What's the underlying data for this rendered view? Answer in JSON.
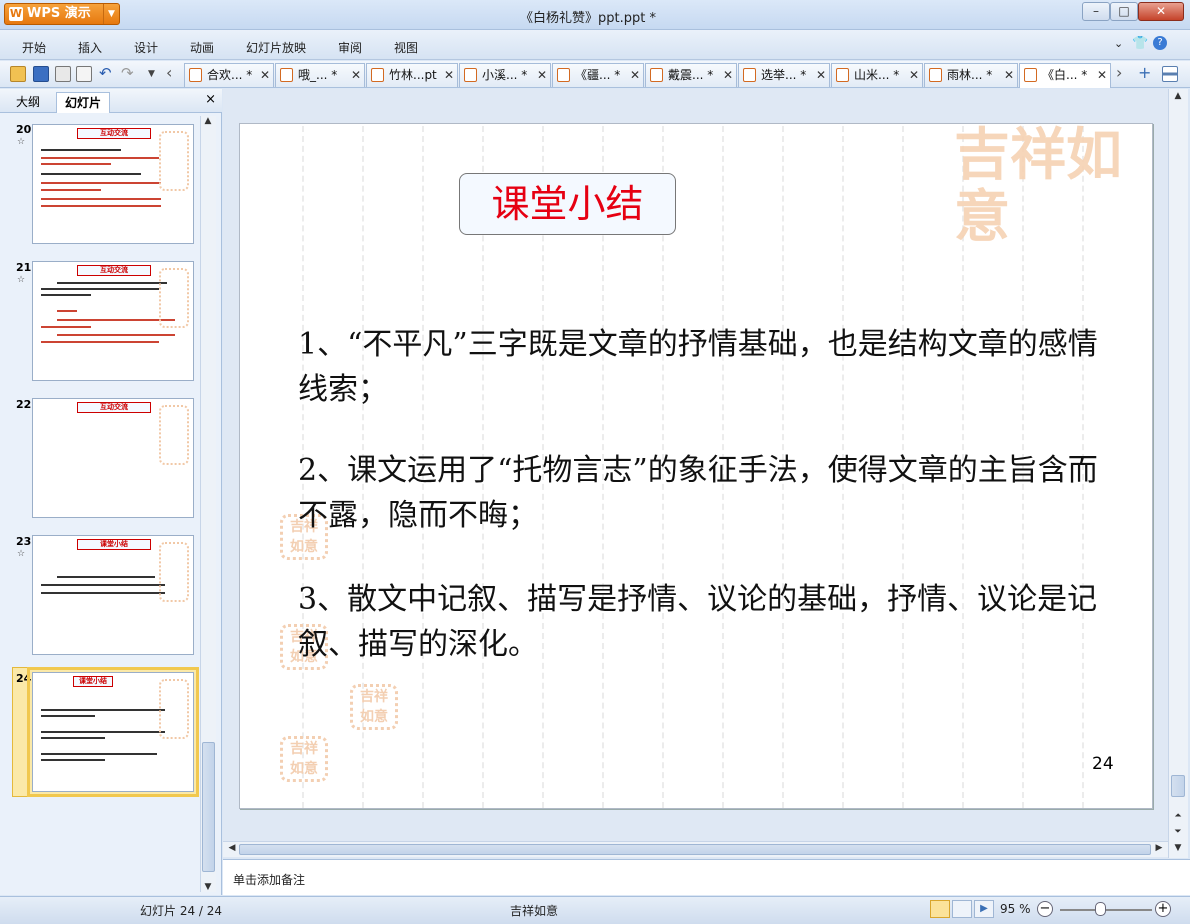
{
  "app": {
    "name": "WPS 演示",
    "doc_title": "《白杨礼赞》ppt.ppt *"
  },
  "menu": [
    "开始",
    "插入",
    "设计",
    "动画",
    "幻灯片放映",
    "审阅",
    "视图"
  ],
  "doc_tabs": [
    "合欢... *",
    "哦_... *",
    "竹林...pt",
    "小溪... *",
    "《疆... *",
    "戴震... *",
    "选举... *",
    "山米... *",
    "雨林... *",
    "《白... *"
  ],
  "panel": {
    "tabs": [
      "大纲",
      "幻灯片"
    ],
    "close": "×"
  },
  "thumbnails": [
    {
      "num": "20",
      "title": "互动交流",
      "star": "☆"
    },
    {
      "num": "21",
      "title": "互动交流",
      "star": "☆"
    },
    {
      "num": "22",
      "title": "互动交流",
      "star": ""
    },
    {
      "num": "23",
      "title": "课堂小结",
      "star": "☆"
    },
    {
      "num": "24",
      "title": "课堂小结",
      "star": "",
      "selected": true
    }
  ],
  "slide": {
    "title": "课堂小结",
    "points": [
      "1、“不平凡”三字既是文章的抒情基础，也是结构文章的感情线索；",
      "2、课文运用了“托物言志”的象征手法，使得文章的主旨含而不露，隐而不晦；",
      "3、散文中记叙、描写是抒情、议论的基础，抒情、议论是记叙、描写的深化。"
    ],
    "page_number": "24",
    "deco_text": "吉祥如意"
  },
  "notes_placeholder": "单击添加备注",
  "status": {
    "slide_pos": "幻灯片 24 / 24",
    "template": "吉祥如意",
    "zoom": "95 %"
  },
  "colors": {
    "title_red": "#e60012",
    "accent_orange": "#e6780f",
    "deco_peach": "#f6d2b3"
  }
}
